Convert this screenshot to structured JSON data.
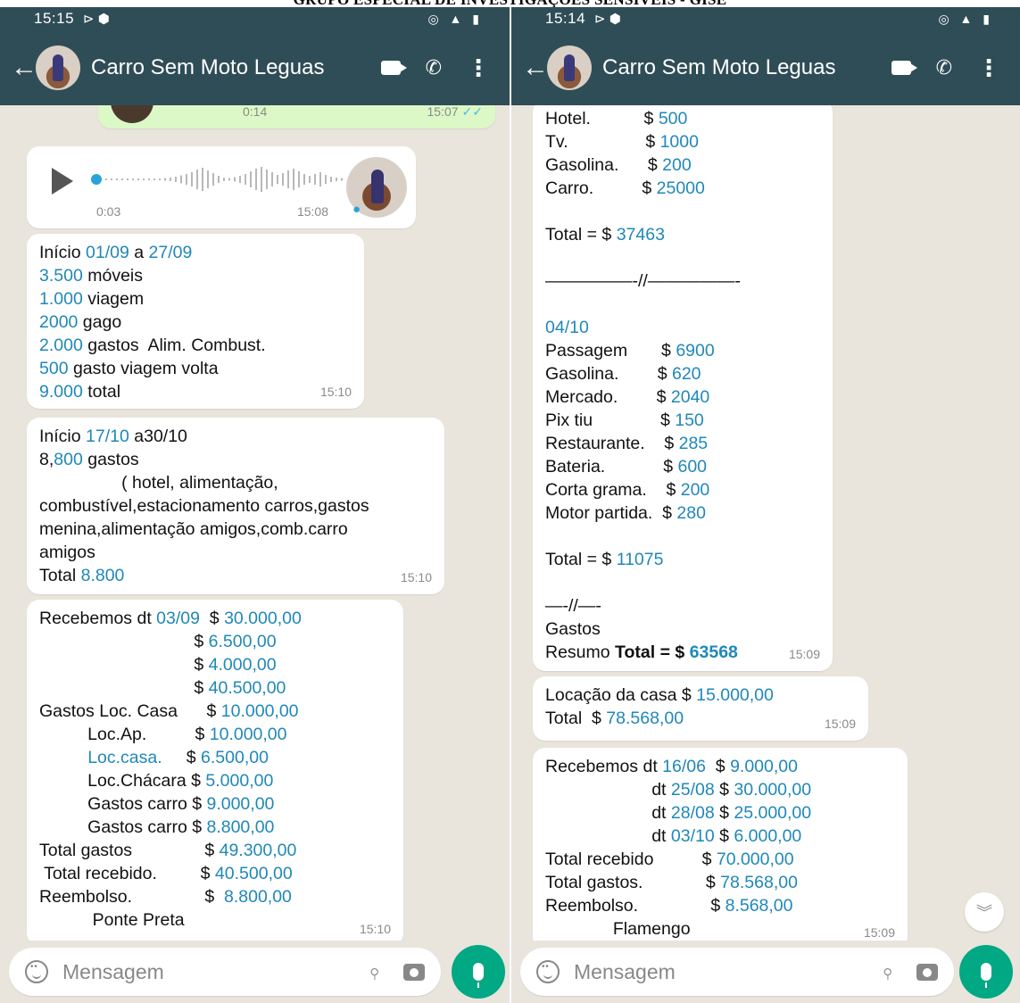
{
  "banner": "GRUPO ESPECIAL DE INVESTIGAÇÕES SENSÍVEIS - GISE",
  "left": {
    "status_time": "15:15",
    "chat_title": "Carro Sem Moto Leguas",
    "audio_out": {
      "duration": "0:14",
      "time": "15:07"
    },
    "audio_in": {
      "duration": "0:03",
      "time": "15:08"
    },
    "messages": [
      {
        "time": "15:10",
        "lines": [
          [
            {
              "t": "Início "
            },
            {
              "t": "01/09",
              "h": 1
            },
            {
              "t": " a "
            },
            {
              "t": "27/09",
              "h": 1
            }
          ],
          [
            {
              "t": "3.500",
              "h": 1
            },
            {
              "t": " móveis"
            }
          ],
          [
            {
              "t": "1.000",
              "h": 1
            },
            {
              "t": " viagem"
            }
          ],
          [
            {
              "t": "2000",
              "h": 1
            },
            {
              "t": " gago"
            }
          ],
          [
            {
              "t": "2.000",
              "h": 1
            },
            {
              "t": " gastos  Alim. Combust."
            }
          ],
          [
            {
              "t": "500",
              "h": 1
            },
            {
              "t": " gasto viagem volta"
            }
          ],
          [
            {
              "t": "9.000",
              "h": 1
            },
            {
              "t": " total"
            }
          ]
        ]
      },
      {
        "time": "15:10",
        "lines": [
          [
            {
              "t": "Início "
            },
            {
              "t": "17/10",
              "h": 1
            },
            {
              "t": " a30/10"
            }
          ],
          [
            {
              "t": "8,"
            },
            {
              "t": "800",
              "h": 1
            },
            {
              "t": " gastos"
            }
          ],
          [
            {
              "t": "                 ( hotel, alimentação,"
            }
          ],
          [
            {
              "t": "combustível,estacionamento carros,gastos"
            }
          ],
          [
            {
              "t": "menina,alimentação amigos,comb.carro"
            }
          ],
          [
            {
              "t": "amigos"
            }
          ],
          [
            {
              "t": "Total "
            },
            {
              "t": "8.800",
              "h": 1
            }
          ]
        ]
      },
      {
        "time": "15:10",
        "lines": [
          [
            {
              "t": "Recebemos dt "
            },
            {
              "t": "03/09",
              "h": 1
            },
            {
              "t": "  $ "
            },
            {
              "t": "30.000,00",
              "h": 1
            }
          ],
          [
            {
              "t": "                                $ "
            },
            {
              "t": "6.500,00",
              "h": 1
            }
          ],
          [
            {
              "t": "                                $ "
            },
            {
              "t": "4.000,00",
              "h": 1
            }
          ],
          [
            {
              "t": "                                $ "
            },
            {
              "t": "40.500,00",
              "h": 1
            }
          ],
          [
            {
              "t": "Gastos Loc. Casa      $ "
            },
            {
              "t": "10.000,00",
              "h": 1
            }
          ],
          [
            {
              "t": "          Loc.Ap.          $ "
            },
            {
              "t": "10.000,00",
              "h": 1
            }
          ],
          [
            {
              "t": "          "
            },
            {
              "t": "Loc.casa.",
              "h": 1
            },
            {
              "t": "     $ "
            },
            {
              "t": "6.500,00",
              "h": 1
            }
          ],
          [
            {
              "t": "          Loc.Chácara $ "
            },
            {
              "t": "5.000,00",
              "h": 1
            }
          ],
          [
            {
              "t": "          Gastos carro $ "
            },
            {
              "t": "9.000,00",
              "h": 1
            }
          ],
          [
            {
              "t": "          Gastos carro $ "
            },
            {
              "t": "8.800,00",
              "h": 1
            }
          ],
          [
            {
              "t": "Total gastos               $ "
            },
            {
              "t": "49.300,00",
              "h": 1
            }
          ],
          [
            {
              "t": " Total recebido.         $ "
            },
            {
              "t": "40.500,00",
              "h": 1
            }
          ],
          [
            {
              "t": "Reembolso.               $  "
            },
            {
              "t": "8.800,00",
              "h": 1
            }
          ],
          [
            {
              "t": "           Ponte Preta"
            }
          ]
        ]
      }
    ],
    "input_placeholder": "Mensagem"
  },
  "right": {
    "status_time": "15:14",
    "chat_title": "Carro Sem Moto Leguas",
    "messages": [
      {
        "time": "15:09",
        "lines": [
          [
            {
              "t": "Hotel.           $ "
            },
            {
              "t": "500",
              "h": 1
            }
          ],
          [
            {
              "t": "Tv.                $ "
            },
            {
              "t": "1000",
              "h": 1
            }
          ],
          [
            {
              "t": "Gasolina.      $ "
            },
            {
              "t": "200",
              "h": 1
            }
          ],
          [
            {
              "t": "Carro.          $ "
            },
            {
              "t": "25000",
              "h": 1
            }
          ],
          [
            {
              "t": ""
            }
          ],
          [
            {
              "t": "Total = $ "
            },
            {
              "t": "37463",
              "h": 1
            }
          ],
          [
            {
              "t": ""
            }
          ],
          [
            {
              "t": "—————-//—————-"
            }
          ],
          [
            {
              "t": ""
            }
          ],
          [
            {
              "t": "04/10",
              "h": 1
            }
          ],
          [
            {
              "t": "Passagem       $ "
            },
            {
              "t": "6900",
              "h": 1
            }
          ],
          [
            {
              "t": "Gasolina.        $ "
            },
            {
              "t": "620",
              "h": 1
            }
          ],
          [
            {
              "t": "Mercado.        $ "
            },
            {
              "t": "2040",
              "h": 1
            }
          ],
          [
            {
              "t": "Pix tiu              $ "
            },
            {
              "t": "150",
              "h": 1
            }
          ],
          [
            {
              "t": "Restaurante.    $ "
            },
            {
              "t": "285",
              "h": 1
            }
          ],
          [
            {
              "t": "Bateria.            $ "
            },
            {
              "t": "600",
              "h": 1
            }
          ],
          [
            {
              "t": "Corta grama.    $ "
            },
            {
              "t": "200",
              "h": 1
            }
          ],
          [
            {
              "t": "Motor partida.  $ "
            },
            {
              "t": "280",
              "h": 1
            }
          ],
          [
            {
              "t": ""
            }
          ],
          [
            {
              "t": "Total = $ "
            },
            {
              "t": "11075",
              "h": 1
            }
          ],
          [
            {
              "t": ""
            }
          ],
          [
            {
              "t": "—-//—-"
            }
          ],
          [
            {
              "t": "Gastos"
            }
          ],
          [
            {
              "t": "Resumo "
            },
            {
              "t": "Total",
              "b": 1
            },
            {
              "t": " = $ ",
              "b": 1
            },
            {
              "t": "63568",
              "h": 1,
              "b": 1
            }
          ]
        ]
      },
      {
        "time": "15:09",
        "lines": [
          [
            {
              "t": "Locação da casa $ "
            },
            {
              "t": "15.000,00",
              "h": 1
            }
          ],
          [
            {
              "t": "Total  $ "
            },
            {
              "t": "78.568,00",
              "h": 1
            }
          ]
        ]
      },
      {
        "time": "15:09",
        "lines": [
          [
            {
              "t": "Recebemos dt "
            },
            {
              "t": "16/06",
              "h": 1
            },
            {
              "t": "  $ "
            },
            {
              "t": "9.000,00",
              "h": 1
            }
          ],
          [
            {
              "t": "                      dt "
            },
            {
              "t": "25/08",
              "h": 1
            },
            {
              "t": " $ "
            },
            {
              "t": "30.000,00",
              "h": 1
            }
          ],
          [
            {
              "t": "                      dt "
            },
            {
              "t": "28/08",
              "h": 1
            },
            {
              "t": " $ "
            },
            {
              "t": "25.000,00",
              "h": 1
            }
          ],
          [
            {
              "t": "                      dt "
            },
            {
              "t": "03/10",
              "h": 1
            },
            {
              "t": " $ "
            },
            {
              "t": "6.000,00",
              "h": 1
            }
          ],
          [
            {
              "t": "Total recebido          $ "
            },
            {
              "t": "70.000,00",
              "h": 1
            }
          ],
          [
            {
              "t": "Total gastos.             $ "
            },
            {
              "t": "78.568,00",
              "h": 1
            }
          ],
          [
            {
              "t": "Reembolso.               $ "
            },
            {
              "t": "8.568,00",
              "h": 1
            }
          ],
          [
            {
              "t": "              Flamengo"
            }
          ]
        ]
      }
    ],
    "input_placeholder": "Mensagem"
  },
  "colors": {
    "header": "#2f4d57",
    "link": "#1f88b8",
    "mic": "#00a884",
    "bubble_out": "#dcf8c6"
  },
  "icons": [
    "back-arrow-icon",
    "video-call-icon",
    "phone-call-icon",
    "more-vert-icon",
    "emoji-icon",
    "attach-icon",
    "camera-icon",
    "mic-icon",
    "chevron-double-down-icon"
  ]
}
